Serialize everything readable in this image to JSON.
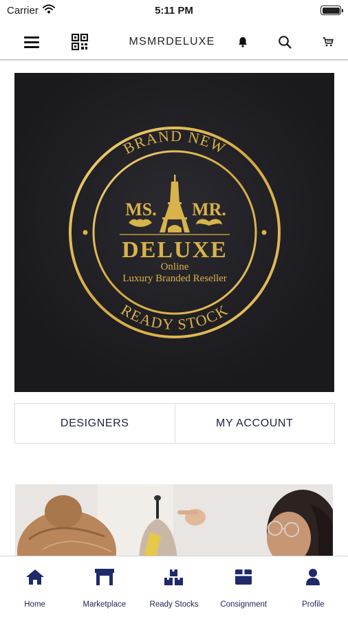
{
  "status_bar": {
    "carrier": "Carrier",
    "time": "5:11 PM",
    "icons": [
      "wifi-icon",
      "battery-icon"
    ]
  },
  "header": {
    "title": "MSMRDELUXE",
    "icons": [
      "hamburger-menu-icon",
      "qr-code-icon",
      "bell-icon",
      "search-icon",
      "cart-icon"
    ]
  },
  "hero_logo": {
    "arc_top": "BRAND NEW",
    "arc_bottom": "READY STOCK",
    "ms": "MS.",
    "mr": "MR.",
    "name": "DELUXE",
    "line1": "Online",
    "line2": "Luxury Branded Reseller",
    "gold": "#d8b24a",
    "background": "#1c1b1d"
  },
  "buttons": {
    "designers": "DESIGNERS",
    "my_account": "MY ACCOUNT"
  },
  "tabs": [
    {
      "label": "Home",
      "icon": "home-icon"
    },
    {
      "label": "Marketplace",
      "icon": "marketplace-icon"
    },
    {
      "label": "Ready Stocks",
      "icon": "boxes-icon"
    },
    {
      "label": "Consignment",
      "icon": "box-icon"
    },
    {
      "label": "Profile",
      "icon": "user-icon"
    }
  ],
  "colors": {
    "accent": "#1f2a6b",
    "text_dark": "#1d2240"
  }
}
